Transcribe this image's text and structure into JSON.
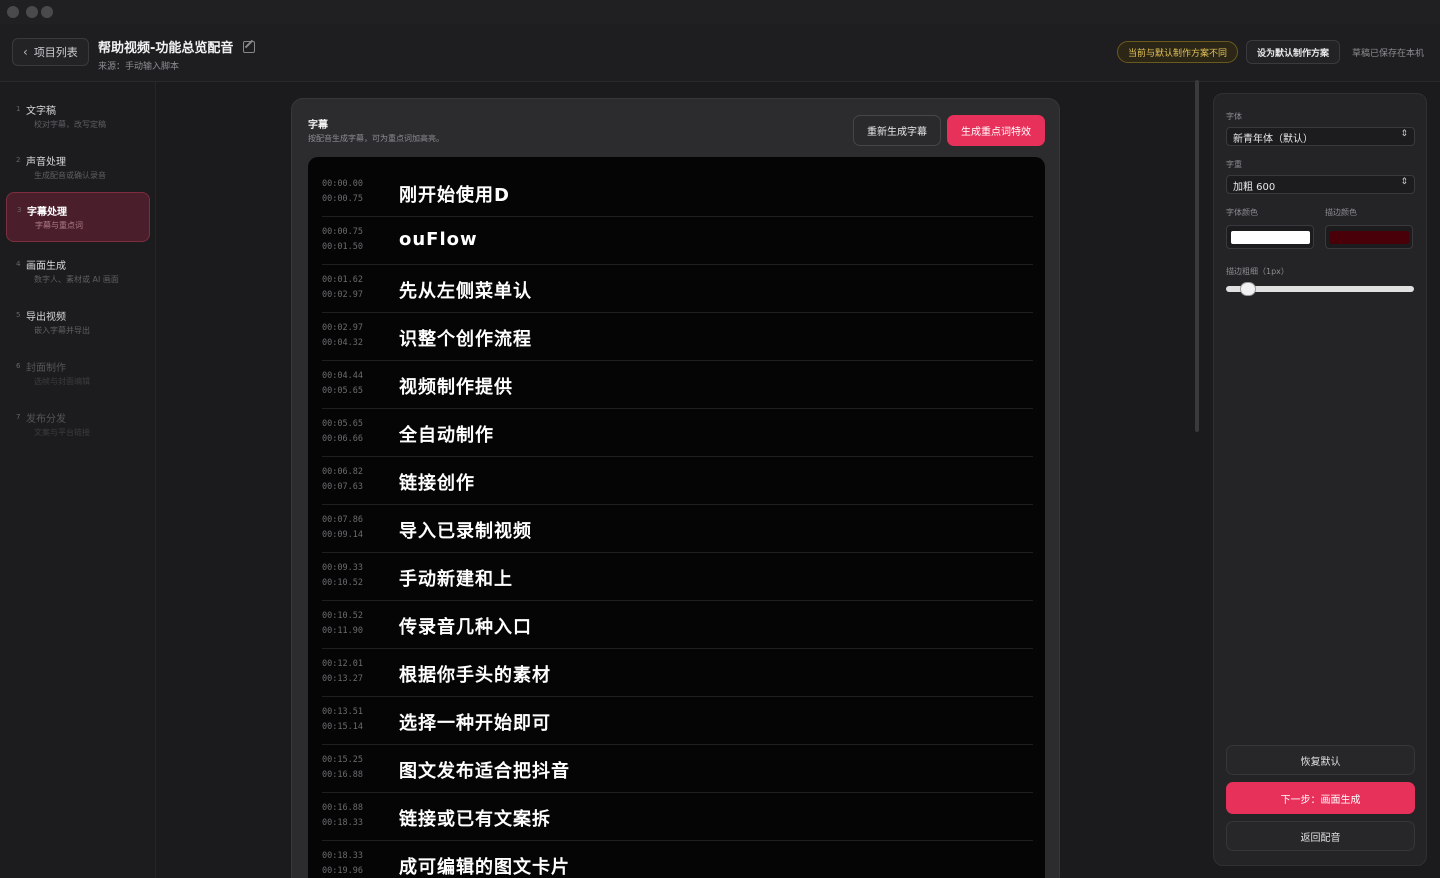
{
  "header": {
    "back_label": "项目列表",
    "project_title": "帮助视频-功能总览配音",
    "source_text": "来源：手动输入脚本",
    "warn_badge": "当前与默认制作方案不同",
    "set_default_label": "设为默认制作方案",
    "saved_text": "草稿已保存在本机"
  },
  "sidebar": {
    "steps": [
      {
        "num": "1",
        "title": "文字稿",
        "sub": "校对字幕，改写定稿"
      },
      {
        "num": "2",
        "title": "声音处理",
        "sub": "生成配音或确认录音"
      },
      {
        "num": "3",
        "title": "字幕处理",
        "sub": "字幕与重点词"
      },
      {
        "num": "4",
        "title": "画面生成",
        "sub": "数字人、素材或 AI 画面"
      },
      {
        "num": "5",
        "title": "导出视频",
        "sub": "嵌入字幕并导出"
      },
      {
        "num": "6",
        "title": "封面制作",
        "sub": "选帧与封面编辑"
      },
      {
        "num": "7",
        "title": "发布分发",
        "sub": "文案与平台链接"
      }
    ]
  },
  "main": {
    "card_title": "字幕",
    "card_sub": "按配音生成字幕，可为重点词加高亮。",
    "regen_label": "重新生成字幕",
    "fx_label": "生成重点词特效",
    "subtitles": [
      {
        "start": "00:00.00",
        "end": "00:00.75",
        "text": "刚开始使用D"
      },
      {
        "start": "00:00.75",
        "end": "00:01.50",
        "text": "ouFlow"
      },
      {
        "start": "00:01.62",
        "end": "00:02.97",
        "text": "先从左侧菜单认"
      },
      {
        "start": "00:02.97",
        "end": "00:04.32",
        "text": "识整个创作流程"
      },
      {
        "start": "00:04.44",
        "end": "00:05.65",
        "text": "视频制作提供"
      },
      {
        "start": "00:05.65",
        "end": "00:06.66",
        "text": "全自动制作"
      },
      {
        "start": "00:06.82",
        "end": "00:07.63",
        "text": "链接创作"
      },
      {
        "start": "00:07.86",
        "end": "00:09.14",
        "text": "导入已录制视频"
      },
      {
        "start": "00:09.33",
        "end": "00:10.52",
        "text": "手动新建和上"
      },
      {
        "start": "00:10.52",
        "end": "00:11.90",
        "text": "传录音几种入口"
      },
      {
        "start": "00:12.01",
        "end": "00:13.27",
        "text": "根据你手头的素材"
      },
      {
        "start": "00:13.51",
        "end": "00:15.14",
        "text": "选择一种开始即可"
      },
      {
        "start": "00:15.25",
        "end": "00:16.88",
        "text": "图文发布适合把抖音"
      },
      {
        "start": "00:16.88",
        "end": "00:18.33",
        "text": "链接或已有文案拆"
      },
      {
        "start": "00:18.33",
        "end": "00:19.96",
        "text": "成可编辑的图文卡片"
      }
    ]
  },
  "panel": {
    "font_label": "字体",
    "font_value": "新青年体（默认）",
    "weight_label": "字重",
    "weight_value": "加粗 600",
    "font_color_label": "字体颜色",
    "stroke_color_label": "描边颜色",
    "stroke_width_label": "描边粗细（1px）",
    "font_color": "#ffffff",
    "stroke_color": "#4a0008",
    "stroke_width": 1,
    "restore_label": "恢复默认",
    "next_label": "下一步：画面生成",
    "back_label": "返回配音"
  },
  "colors": {
    "accent": "#e8315a",
    "active_step_bg": "#4a1f2b"
  }
}
